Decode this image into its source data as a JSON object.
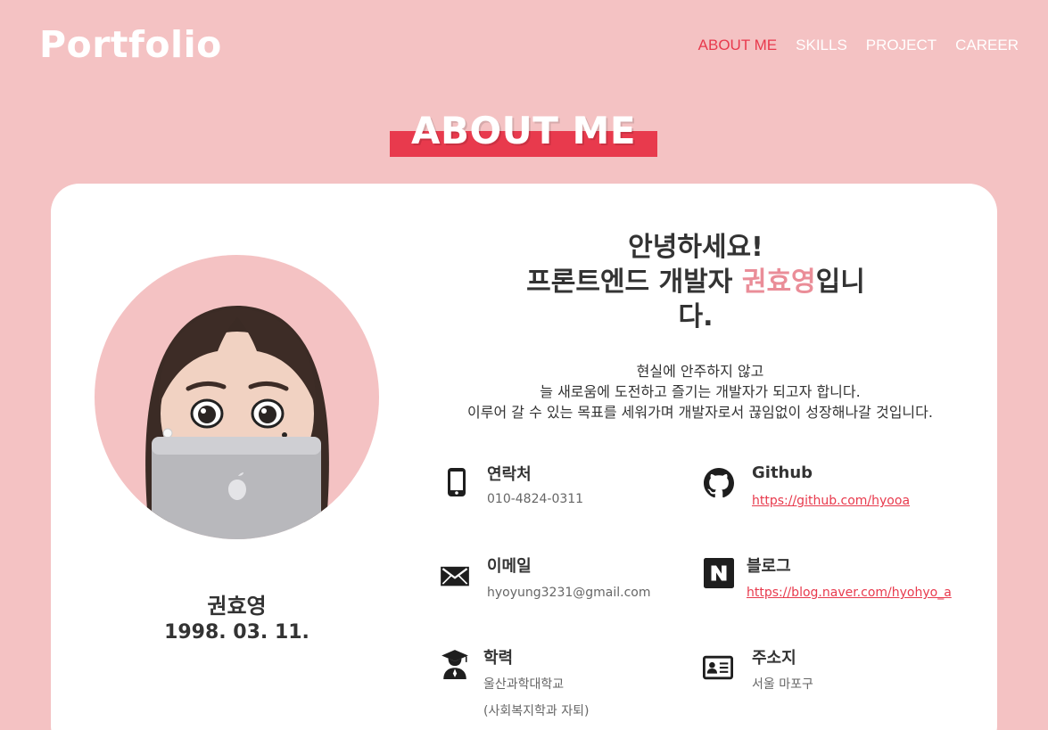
{
  "header": {
    "logo": "Portfolio",
    "nav": [
      {
        "label": "ABOUT ME",
        "active": true
      },
      {
        "label": "SKILLS",
        "active": false
      },
      {
        "label": "PROJECT",
        "active": false
      },
      {
        "label": "CAREER",
        "active": false
      }
    ]
  },
  "section": {
    "title": "ABOUT ME"
  },
  "profile": {
    "avatar_icon": "memoji-with-laptop",
    "name": "권효영",
    "birth": "1998. 03. 11."
  },
  "greeting": {
    "line1": "안녕하세요!",
    "line2_prefix": "프론트엔드 개발자 ",
    "line2_name": "권효영",
    "line2_suffix": "입니",
    "line3": "다."
  },
  "intro": [
    "현실에 안주하지 않고",
    "늘 새로움에 도전하고 즐기는 개발자가 되고자 합니다.",
    "이루어 갈 수 있는 목표를 세워가며 개발자로서 끊임없이 성장해나갈 것입니다."
  ],
  "info": {
    "contact": {
      "icon": "smartphone-icon",
      "label": "연락처",
      "value": "010-4824-0311"
    },
    "github": {
      "icon": "github-icon",
      "label": "Github",
      "value": "https://github.com/hyooa"
    },
    "email": {
      "icon": "envelope-icon",
      "label": "이메일",
      "value": "hyoyung3231@gmail.com"
    },
    "blog": {
      "icon": "naver-icon",
      "label": "블로그",
      "value": "https://blog.naver.com/hyohyo_a"
    },
    "education": {
      "icon": "graduate-icon",
      "label": "학력",
      "value1": "울산과학대학교",
      "value2": "(사회복지학과 자퇴)"
    },
    "address": {
      "icon": "id-card-icon",
      "label": "주소지",
      "value": "서울 마포구"
    }
  },
  "colors": {
    "background": "#f4c2c3",
    "accent": "#e83a4d",
    "highlight": "#ea8d98",
    "card": "#ffffff"
  }
}
